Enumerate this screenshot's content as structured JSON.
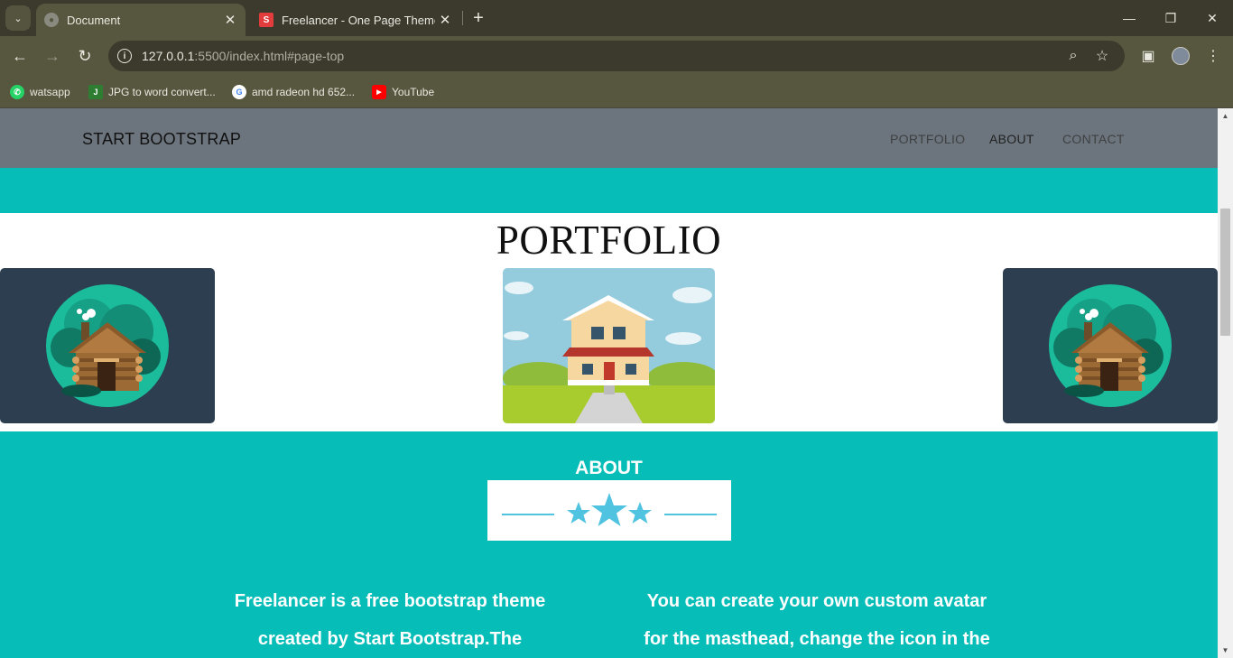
{
  "browser": {
    "tabs": [
      {
        "title": "Document",
        "active": true
      },
      {
        "title": "Freelancer - One Page Theme -",
        "active": false
      }
    ],
    "url_host": "127.0.0.1",
    "url_rest": ":5500/index.html#page-top",
    "bookmarks": [
      {
        "label": "watsapp",
        "icon": "whatsapp-icon",
        "color": "#25d366"
      },
      {
        "label": "JPG to word convert...",
        "icon": "jpg-converter-icon",
        "color": "#2e7d32"
      },
      {
        "label": "amd radeon hd 652...",
        "icon": "google-icon",
        "color": "#4285f4"
      },
      {
        "label": "YouTube",
        "icon": "youtube-icon",
        "color": "#ff0000"
      }
    ]
  },
  "site": {
    "brand": "START BOOTSTRAP",
    "nav": [
      {
        "label": "PORTFOLIO"
      },
      {
        "label": "ABOUT"
      },
      {
        "label": "CONTACT"
      }
    ],
    "portfolio_title": "PORTFOLIO",
    "about_title": "ABOUT",
    "about_left_1": "Freelancer is a free bootstrap theme",
    "about_left_2": "created by Start Bootstrap.The",
    "about_right_1": "You can create your own custom avatar",
    "about_right_2": "for the masthead, change the icon in the"
  },
  "colors": {
    "teal": "#06bdb7",
    "navbar": "#6c757d",
    "card_dark": "#2c3e50",
    "star_blue": "#4fc3e0"
  }
}
